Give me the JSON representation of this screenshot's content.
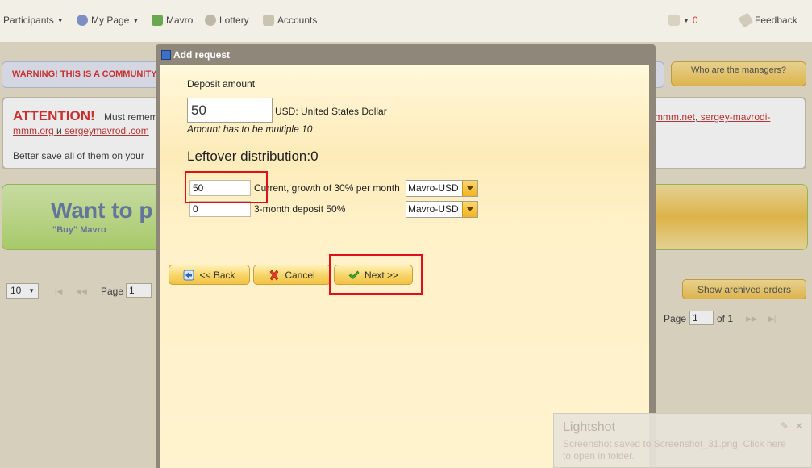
{
  "nav": {
    "participants": "Participants",
    "my_page": "My Page",
    "mavro": "Mavro",
    "lottery": "Lottery",
    "accounts": "Accounts",
    "messages_count": "0",
    "feedback": "Feedback"
  },
  "background": {
    "warning": "WARNING! THIS IS A COMMUNITY C",
    "managers_button": "Who are the managers?",
    "attention_title": "ATTENTION!",
    "attention_line1": "Must remem",
    "attention_link_left": "mmm.org",
    "attention_and": "и",
    "attention_link_left2": "sergeymavrodi.com",
    "attention_link_right": "mmm.net",
    "attention_link_right2": "sergey-mavrodi-",
    "attention_line3": "Better save all of them on your",
    "want_title": "Want to p",
    "want_sub": "\"Buy\" Mavro",
    "page_size": "10",
    "page_label": "Page",
    "page_value": "1",
    "page_label_right": "Page",
    "page_value_right": "1",
    "of_label": "of 1",
    "archived_button": "Show archived orders"
  },
  "dialog": {
    "title": "Add request",
    "deposit_label": "Deposit amount",
    "amount_value": "50",
    "currency": "USD: United States Dollar",
    "hint": "Amount has to be multiple 10",
    "leftover_heading": "Leftover distribution:0",
    "rows": [
      {
        "value": "50",
        "label": "Current, growth of 30% per month",
        "select": "Mavro-USD"
      },
      {
        "value": "0",
        "label": "3-month deposit 50%",
        "select": "Mavro-USD"
      }
    ],
    "back_button": "<< Back",
    "cancel_button": "Cancel",
    "next_button": "Next >>"
  },
  "toast": {
    "title": "Lightshot",
    "text": "Screenshot saved to Screenshot_31.png. Click here to open in folder."
  }
}
